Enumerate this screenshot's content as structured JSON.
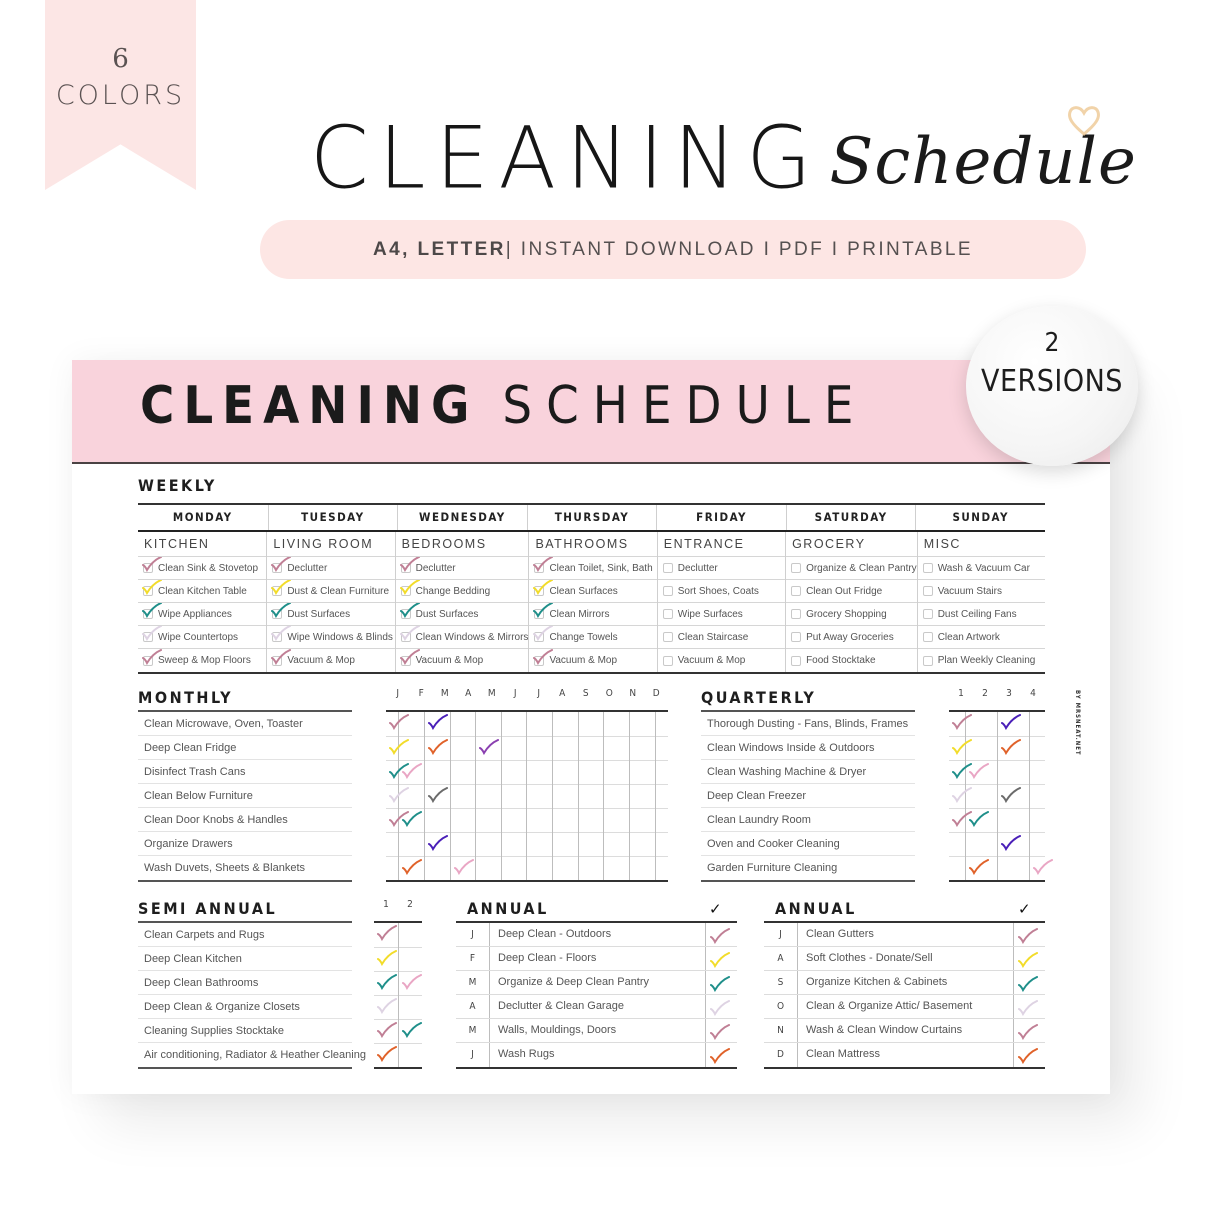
{
  "ribbon": {
    "count": "6",
    "label": "COLORS"
  },
  "hero": {
    "title_main": "CLEANING",
    "title_script": "Schedule",
    "decoration": "heart-icon"
  },
  "pill": {
    "bold": "A4, LETTER",
    "rest": "| INSTANT DOWNLOAD I PDF I PRINTABLE"
  },
  "badge": {
    "count": "2",
    "label": "VERSIONS"
  },
  "page": {
    "banner_bold": "CLEANING",
    "banner_light": "SCHEDULE",
    "credit": "BY MRSNEAT.NET"
  },
  "colors": {
    "mauve": "#c07f95",
    "yellow": "#f2dc2a",
    "teal": "#1f8f8a",
    "lavender": "#ded3e3",
    "purple": "#4a1fb8",
    "orange": "#e0622a",
    "violet": "#8a3fb0",
    "pink": "#e9a6c4",
    "gray": "#6b6b6b",
    "banner": "#f9d3dc",
    "ribbon": "#fce6e5"
  },
  "weekly": {
    "title": "WEEKLY",
    "columns": [
      {
        "day": "MONDAY",
        "room": "KITCHEN",
        "tasks": [
          {
            "label": "Clean Sink & Stovetop",
            "check": "mauve"
          },
          {
            "label": "Clean Kitchen Table",
            "check": "yellow"
          },
          {
            "label": "Wipe Appliances",
            "check": "teal"
          },
          {
            "label": "Wipe Countertops",
            "check": "lavender"
          },
          {
            "label": "Sweep & Mop Floors",
            "check": "mauve"
          }
        ]
      },
      {
        "day": "TUESDAY",
        "room": "LIVING ROOM",
        "tasks": [
          {
            "label": "Declutter",
            "check": "mauve"
          },
          {
            "label": "Dust & Clean Furniture",
            "check": "yellow"
          },
          {
            "label": "Dust Surfaces",
            "check": "teal"
          },
          {
            "label": "Wipe Windows & Blinds",
            "check": "lavender"
          },
          {
            "label": "Vacuum & Mop",
            "check": "mauve"
          }
        ]
      },
      {
        "day": "WEDNESDAY",
        "room": "BEDROOMS",
        "tasks": [
          {
            "label": "Declutter",
            "check": "mauve"
          },
          {
            "label": "Change Bedding",
            "check": "yellow"
          },
          {
            "label": "Dust Surfaces",
            "check": "teal"
          },
          {
            "label": "Clean Windows & Mirrors",
            "check": "lavender"
          },
          {
            "label": "Vacuum & Mop",
            "check": "mauve"
          }
        ]
      },
      {
        "day": "THURSDAY",
        "room": "BATHROOMS",
        "tasks": [
          {
            "label": "Clean Toilet, Sink, Bath",
            "check": "mauve"
          },
          {
            "label": "Clean Surfaces",
            "check": "yellow"
          },
          {
            "label": "Clean Mirrors",
            "check": "teal"
          },
          {
            "label": "Change Towels",
            "check": "lavender"
          },
          {
            "label": "Vacuum & Mop",
            "check": "mauve"
          }
        ]
      },
      {
        "day": "FRIDAY",
        "room": "ENTRANCE",
        "tasks": [
          {
            "label": "Declutter",
            "check": null
          },
          {
            "label": "Sort Shoes, Coats",
            "check": null
          },
          {
            "label": "Wipe Surfaces",
            "check": null
          },
          {
            "label": "Clean Staircase",
            "check": null
          },
          {
            "label": "Vacuum & Mop",
            "check": null
          }
        ]
      },
      {
        "day": "SATURDAY",
        "room": "GROCERY",
        "tasks": [
          {
            "label": "Organize & Clean Pantry",
            "check": null
          },
          {
            "label": "Clean Out Fridge",
            "check": null
          },
          {
            "label": "Grocery Shopping",
            "check": null
          },
          {
            "label": "Put Away Groceries",
            "check": null
          },
          {
            "label": "Food Stocktake",
            "check": null
          }
        ]
      },
      {
        "day": "SUNDAY",
        "room": "MISC",
        "tasks": [
          {
            "label": "Wash & Vacuum Car",
            "check": null
          },
          {
            "label": "Vacuum Stairs",
            "check": null
          },
          {
            "label": "Dust Ceiling Fans",
            "check": null
          },
          {
            "label": "Clean Artwork",
            "check": null
          },
          {
            "label": "Plan Weekly Cleaning",
            "check": null
          }
        ]
      }
    ]
  },
  "monthly": {
    "title": "MONTHLY",
    "months": [
      "J",
      "F",
      "M",
      "A",
      "M",
      "J",
      "J",
      "A",
      "S",
      "O",
      "N",
      "D"
    ],
    "tasks": [
      {
        "label": "Clean Microwave, Oven, Toaster",
        "checks": {
          "0": "mauve",
          "2": "purple"
        }
      },
      {
        "label": "Deep Clean Fridge",
        "checks": {
          "0": "yellow",
          "2": "orange",
          "4": "violet"
        }
      },
      {
        "label": "Disinfect Trash Cans",
        "checks": {
          "0": "teal",
          "1": "pink"
        }
      },
      {
        "label": "Clean Below Furniture",
        "checks": {
          "0": "lavender",
          "2": "gray"
        }
      },
      {
        "label": "Clean Door Knobs & Handles",
        "checks": {
          "0": "mauve",
          "1": "teal"
        }
      },
      {
        "label": "Organize Drawers",
        "checks": {
          "2": "purple"
        }
      },
      {
        "label": "Wash Duvets, Sheets & Blankets",
        "checks": {
          "1": "orange",
          "3": "pink"
        }
      }
    ]
  },
  "quarterly": {
    "title": "QUARTERLY",
    "quarters": [
      "1",
      "2",
      "3",
      "4"
    ],
    "tasks": [
      {
        "label": "Thorough Dusting - Fans, Blinds, Frames",
        "checks": {
          "0": "mauve",
          "2": "purple"
        }
      },
      {
        "label": "Clean Windows Inside & Outdoors",
        "checks": {
          "0": "yellow",
          "2": "orange"
        }
      },
      {
        "label": "Clean Washing Machine & Dryer",
        "checks": {
          "0": "teal",
          "1": "pink"
        }
      },
      {
        "label": "Deep Clean Freezer",
        "checks": {
          "0": "lavender",
          "2": "gray"
        }
      },
      {
        "label": "Clean Laundry Room",
        "checks": {
          "0": "mauve",
          "1": "teal"
        }
      },
      {
        "label": "Oven and Cooker Cleaning",
        "checks": {
          "2": "purple"
        }
      },
      {
        "label": "Garden Furniture Cleaning",
        "checks": {
          "1": "orange",
          "3": "pink"
        }
      }
    ]
  },
  "semi_annual": {
    "title": "SEMI ANNUAL",
    "halves": [
      "1",
      "2"
    ],
    "tasks": [
      {
        "label": "Clean Carpets and Rugs",
        "checks": {
          "0": "mauve"
        }
      },
      {
        "label": "Deep Clean Kitchen",
        "checks": {
          "0": "yellow"
        }
      },
      {
        "label": "Deep Clean Bathrooms",
        "checks": {
          "0": "teal",
          "1": "pink"
        }
      },
      {
        "label": "Deep Clean & Organize Closets",
        "checks": {
          "0": "lavender"
        }
      },
      {
        "label": "Cleaning Supplies Stocktake",
        "checks": {
          "0": "mauve",
          "1": "teal"
        }
      },
      {
        "label": "Air conditioning, Radiator & Heather Cleaning",
        "checks": {
          "0": "orange"
        }
      }
    ]
  },
  "annual_1": {
    "title": "ANNUAL",
    "header_icon": "✓",
    "rows": [
      {
        "month": "J",
        "label": "Deep Clean - Outdoors",
        "check": "mauve"
      },
      {
        "month": "F",
        "label": "Deep Clean - Floors",
        "check": "yellow"
      },
      {
        "month": "M",
        "label": "Organize & Deep Clean Pantry",
        "check": "teal"
      },
      {
        "month": "A",
        "label": "Declutter & Clean Garage",
        "check": "lavender"
      },
      {
        "month": "M",
        "label": "Walls, Mouldings, Doors",
        "check": "mauve"
      },
      {
        "month": "J",
        "label": "Wash Rugs",
        "check": "orange"
      }
    ]
  },
  "annual_2": {
    "title": "ANNUAL",
    "header_icon": "✓",
    "rows": [
      {
        "month": "J",
        "label": "Clean Gutters",
        "check": "mauve"
      },
      {
        "month": "A",
        "label": "Soft Clothes - Donate/Sell",
        "check": "yellow"
      },
      {
        "month": "S",
        "label": "Organize Kitchen & Cabinets",
        "check": "teal"
      },
      {
        "month": "O",
        "label": "Clean & Organize Attic/ Basement",
        "check": "lavender"
      },
      {
        "month": "N",
        "label": "Wash & Clean Window Curtains",
        "check": "mauve"
      },
      {
        "month": "D",
        "label": "Clean Mattress",
        "check": "orange"
      }
    ]
  }
}
